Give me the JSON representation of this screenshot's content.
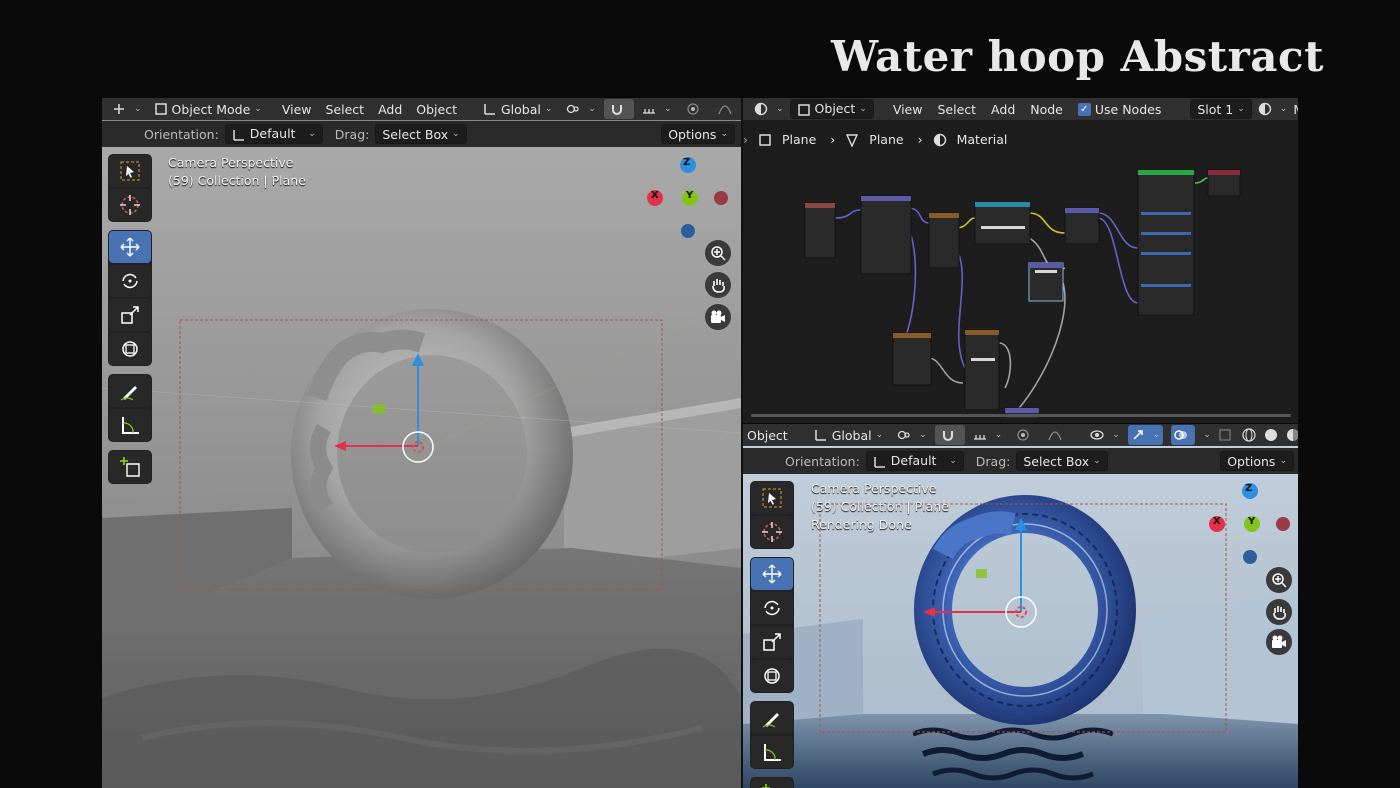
{
  "slide_title": "Water hoop Abstract",
  "left": {
    "header": {
      "mode_label": "Object Mode",
      "menu": [
        "View",
        "Select",
        "Add",
        "Object"
      ],
      "transform_orientation": "Global"
    },
    "toolsettings": {
      "orientation_label": "Orientation:",
      "orientation_value": "Default",
      "drag_label": "Drag:",
      "drag_value": "Select Box",
      "options_label": "Options"
    },
    "overlay": {
      "line1": "Camera Perspective",
      "line2": "(59) Collection | Plane"
    },
    "gizmo": {
      "x": "X",
      "y": "Y",
      "z": "Z"
    }
  },
  "node_editor": {
    "header": {
      "object_label": "Object",
      "menu": [
        "View",
        "Select",
        "Add",
        "Node"
      ],
      "use_nodes_label": "Use Nodes",
      "slot_label": "Slot 1",
      "cut_label": "Ma"
    },
    "breadcrumb": [
      "Plane",
      "Plane",
      "Material"
    ]
  },
  "right": {
    "header": {
      "object_label": "Object",
      "transform_orientation": "Global"
    },
    "toolsettings": {
      "orientation_label": "Orientation:",
      "orientation_value": "Default",
      "drag_label": "Drag:",
      "drag_value": "Select Box",
      "options_label": "Options"
    },
    "overlay": {
      "line1": "Camera Perspective",
      "line2": "(59) Collection | Plane",
      "line3": "Rendering Done"
    },
    "gizmo": {
      "x": "X",
      "y": "Y",
      "z": "Z"
    }
  },
  "colors": {
    "accent": "#4772b3",
    "axis_x": "#e2324a",
    "axis_y": "#84c31a",
    "axis_z": "#2c8fdf",
    "panel": "#303030"
  }
}
